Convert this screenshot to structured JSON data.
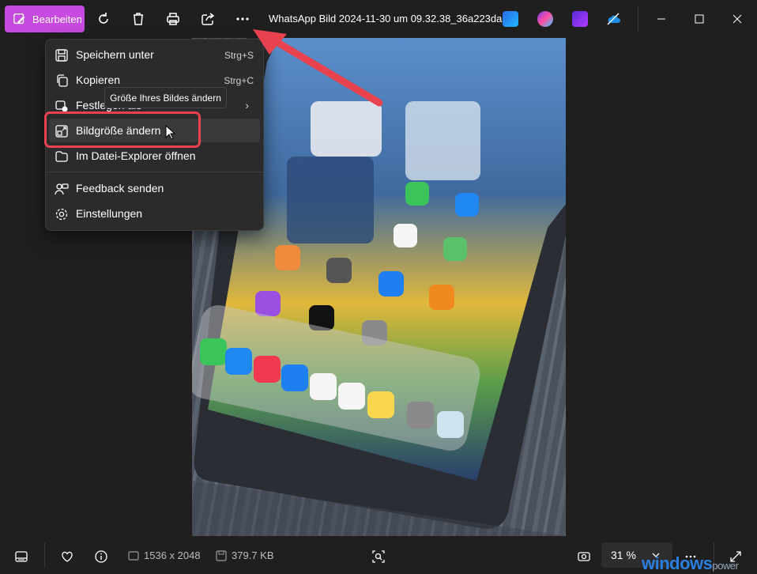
{
  "toolbar": {
    "edit_label": "Bearbeiten",
    "title": "WhatsApp Bild 2024-11-30 um 09.32.38_36a223da...",
    "icons": [
      "rotate-icon",
      "delete-icon",
      "print-icon",
      "share-icon",
      "more-icon"
    ],
    "app_icons": [
      "designer-icon",
      "copilot-icon",
      "clipchamp-icon",
      "onedrive-icon"
    ]
  },
  "window_controls": [
    "minimize",
    "maximize",
    "close"
  ],
  "menu": {
    "items": [
      {
        "label": "Speichern unter",
        "shortcut": "Strg+S",
        "icon": "save-icon"
      },
      {
        "label": "Kopieren",
        "shortcut": "Strg+C",
        "icon": "copy-icon"
      },
      {
        "label": "Festlegen als",
        "icon": "set-as-icon",
        "submenu": true
      },
      {
        "label": "Bildgröße ändern",
        "icon": "resize-icon"
      },
      {
        "label": "Im Datei-Explorer öffnen",
        "icon": "folder-icon"
      },
      {
        "label": "Feedback senden",
        "icon": "feedback-icon"
      },
      {
        "label": "Einstellungen",
        "icon": "settings-icon"
      }
    ],
    "tooltip": "Größe Ihres Bildes ändern"
  },
  "status": {
    "dimensions": "1536 x 2048",
    "size": "379.7 KB",
    "zoom": "31 %"
  },
  "watermark": {
    "brand": "windows",
    "suffix": "power"
  },
  "colors": {
    "accent": "#c74be0",
    "highlight": "#e8424f"
  }
}
